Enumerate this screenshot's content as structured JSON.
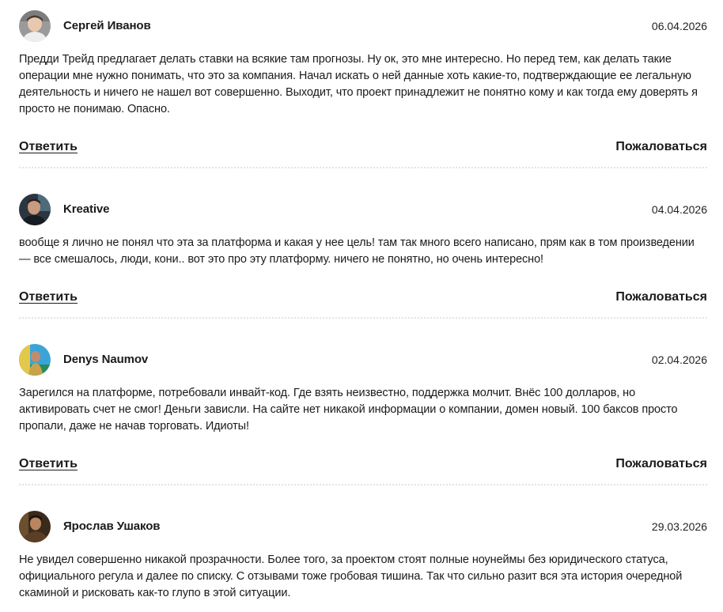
{
  "comments": [
    {
      "author": "Сергей Иванов",
      "date": "06.04.2026",
      "text": "Предди Трейд предлагает делать ставки на всякие там прогнозы. Ну ок, это мне интересно. Но перед тем, как делать такие операции мне нужно понимать, что это за компания. Начал искать о ней данные хоть какие-то, подтверждающие ее легальную деятельность и ничего не нашел вот совершенно. Выходит, что проект принадлежит не понятно кому и как тогда ему доверять я просто не понимаю. Опасно.",
      "reply_label": "Ответить",
      "report_label": "Пожаловаться"
    },
    {
      "author": "Kreative",
      "date": "04.04.2026",
      "text": "вообще я лично не понял что эта за платформа и какая у нее цель! там так много всего написано, прям как в том произведении — все смешалось, люди, кони.. вот это про эту платформу. ничего не понятно, но очень интересно!",
      "reply_label": "Ответить",
      "report_label": "Пожаловаться"
    },
    {
      "author": "Denys Naumov",
      "date": "02.04.2026",
      "text": "Зарегился на платформе, потребовали инвайт-код. Где взять неизвестно, поддержка молчит. Внёс 100 долларов, но активировать счет не смог! Деньги зависли. На сайте нет никакой информации о компании, домен новый. 100 баксов просто пропали, даже не начав торговать. Идиоты!",
      "reply_label": "Ответить",
      "report_label": "Пожаловаться"
    },
    {
      "author": "Ярослав Ушаков",
      "date": "29.03.2026",
      "text": "Не увидел совершенно никакой прозрачности. Более того, за проектом стоят полные ноунеймы без юридического статуса, официального регула и далее по списку. С отзывами тоже гробовая тишина. Так что сильно разит вся эта история очередной скаминой и рисковать как-то глупо в этой ситуации."
    }
  ]
}
